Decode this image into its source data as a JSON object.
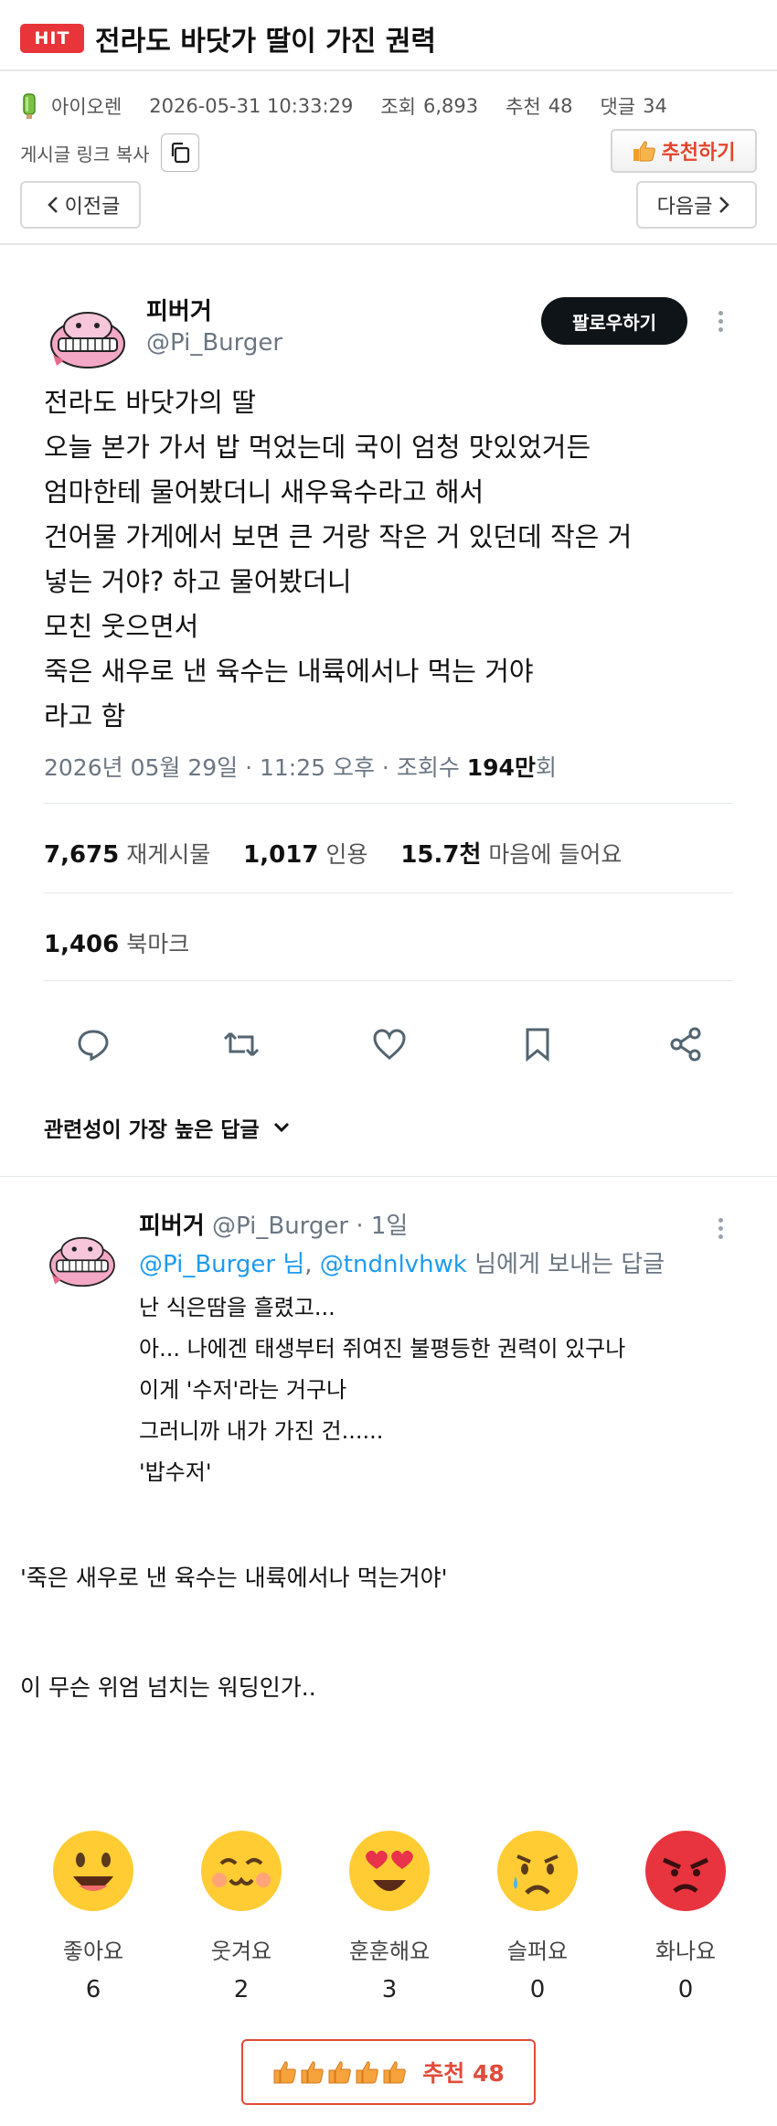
{
  "header": {
    "badge": "HIT",
    "title": "전라도 바닷가 딸이 가진 권력"
  },
  "meta": {
    "author": "아이오렌",
    "datetime": "2026-05-31 10:33:29",
    "views_label": "조회",
    "views": "6,893",
    "likes_label": "추천",
    "likes": "48",
    "comments_label": "댓글",
    "comments": "34",
    "copy_link_label": "게시글 링크 복사",
    "recommend_button": "추천하기"
  },
  "nav": {
    "prev": "이전글",
    "next": "다음글"
  },
  "tweet": {
    "name": "피버거",
    "handle": "@Pi_Burger",
    "follow": "팔로우하기",
    "lines": [
      "전라도 바닷가의 딸",
      "오늘 본가 가서 밥 먹었는데 국이 엄청 맛있었거든",
      "엄마한테 물어봤더니 새우육수라고 해서",
      "건어물 가게에서 보면 큰 거랑 작은 거 있던데 작은 거",
      "넣는 거야? 하고 물어봤더니",
      "모친 웃으면서",
      "죽은 새우로 낸 육수는 내륙에서나 먹는 거야",
      "라고 함"
    ],
    "date_text": "2026년 05월 29일 · 11:25 오후 · 조회수 ",
    "views_bold": "194만",
    "views_suffix": "회",
    "stats": {
      "retweets": "7,675",
      "retweets_label": "재게시물",
      "quotes": "1,017",
      "quotes_label": "인용",
      "likes": "15.7천",
      "likes_label": "마음에 들어요",
      "bookmarks": "1,406",
      "bookmarks_label": "북마크"
    },
    "reply_filter": "관련성이 가장 높은 답글"
  },
  "reply": {
    "name": "피버거",
    "handle": "@Pi_Burger · 1일",
    "mention1": "@Pi_Burger 님",
    "sep": ", ",
    "mention2": "@tndnlvhwk",
    "to_suffix": " 님에게 보내는 답글",
    "lines": [
      "난 식은땀을 흘렸고...",
      "아... 나에겐 태생부터 쥐여진 불평등한 권력이 있구나",
      "이게 '수저'라는 거구나",
      "그러니까 내가 가진 건......",
      "'밥수저'"
    ]
  },
  "commentary": [
    "'죽은 새우로 낸 육수는 내륙에서나 먹는거야'",
    "이 무슨 위엄 넘치는 워딩인가.."
  ],
  "reactions": [
    {
      "label": "좋아요",
      "count": "6"
    },
    {
      "label": "웃겨요",
      "count": "2"
    },
    {
      "label": "훈훈해요",
      "count": "3"
    },
    {
      "label": "슬퍼요",
      "count": "0"
    },
    {
      "label": "화나요",
      "count": "0"
    }
  ],
  "bottom_recommend": "추천 48",
  "colors": {
    "badge_red": "#e8353a",
    "mention_blue": "#1d9bf0",
    "recommend_red": "#e24a3a"
  }
}
